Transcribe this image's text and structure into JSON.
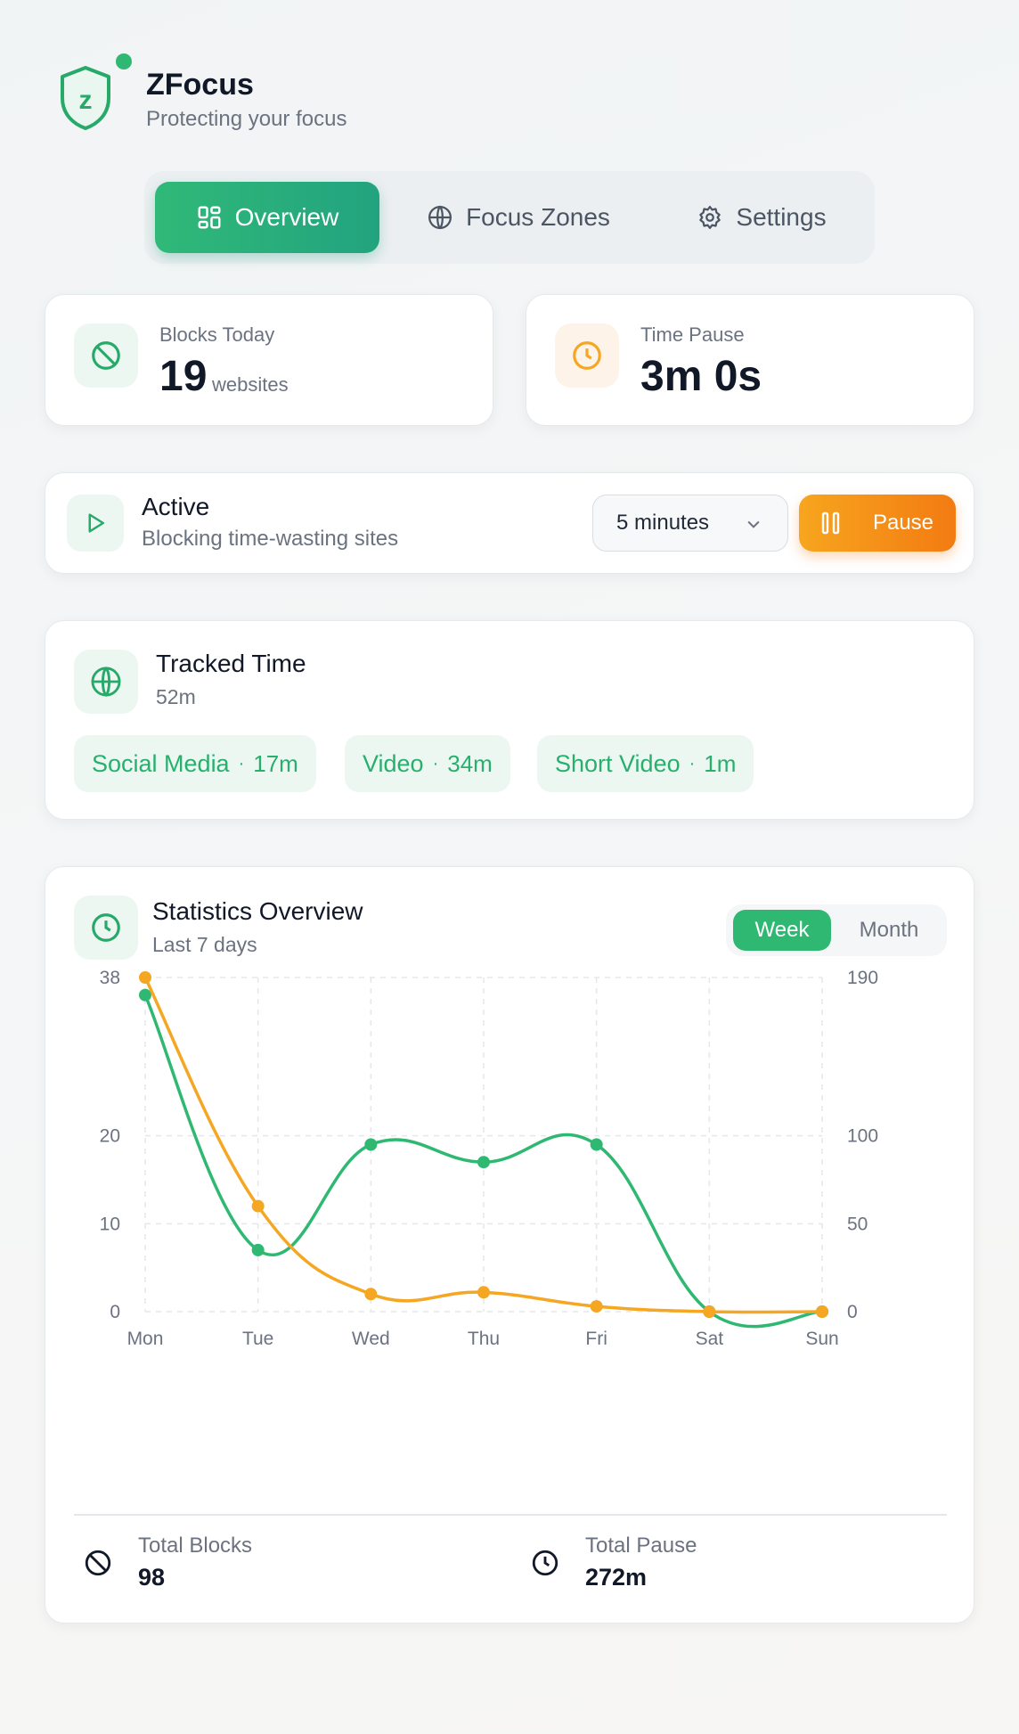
{
  "brand": {
    "title": "ZFocus",
    "subtitle": "Protecting your focus",
    "logo_letter": "z",
    "accent": "#2fb872"
  },
  "nav": {
    "tabs": [
      {
        "label": "Overview",
        "icon": "grid-icon",
        "active": true
      },
      {
        "label": "Focus Zones",
        "icon": "globe-icon",
        "active": false
      },
      {
        "label": "Settings",
        "icon": "gear-icon",
        "active": false
      }
    ]
  },
  "stats": {
    "blocks": {
      "label": "Blocks Today",
      "value": "19",
      "unit": "websites",
      "icon": "block-icon"
    },
    "pause": {
      "label": "Time Pause",
      "value": "3m 0s",
      "icon": "clock-icon"
    }
  },
  "status": {
    "title": "Active",
    "subtitle": "Blocking time-wasting sites",
    "icon": "play-icon",
    "duration": "5 minutes",
    "pause_label": "Pause",
    "pause_color": "#f48515"
  },
  "tracked": {
    "title": "Tracked Time",
    "total": "52m",
    "icon": "globe-icon",
    "chips": [
      {
        "name": "Social Media",
        "value": "17m"
      },
      {
        "name": "Video",
        "value": "34m"
      },
      {
        "name": "Short Video",
        "value": "1m"
      }
    ]
  },
  "statistics": {
    "title": "Statistics Overview",
    "subtitle": "Last 7 days",
    "icon": "clock-icon",
    "range_options": [
      "Week",
      "Month"
    ],
    "range_selected": "Week",
    "totals": {
      "blocks_label": "Total Blocks",
      "blocks_value": "98",
      "pause_label": "Total Pause",
      "pause_value": "272m"
    }
  },
  "chart_data": {
    "type": "line",
    "categories": [
      "Mon",
      "Tue",
      "Wed",
      "Thu",
      "Fri",
      "Sat",
      "Sun"
    ],
    "series": [
      {
        "values": [
          36,
          7,
          19,
          17,
          19,
          0,
          0
        ],
        "axis": "left",
        "color": "#2fb872"
      },
      {
        "values": [
          190,
          60,
          10,
          11,
          3,
          0,
          0
        ],
        "axis": "right",
        "color": "#f5a623"
      }
    ],
    "left_ticks": [
      0,
      10,
      20,
      38
    ],
    "right_ticks": [
      0,
      50,
      100,
      190
    ],
    "ylim_left": [
      0,
      38
    ],
    "ylim_right": [
      0,
      190
    ],
    "grid": true
  }
}
